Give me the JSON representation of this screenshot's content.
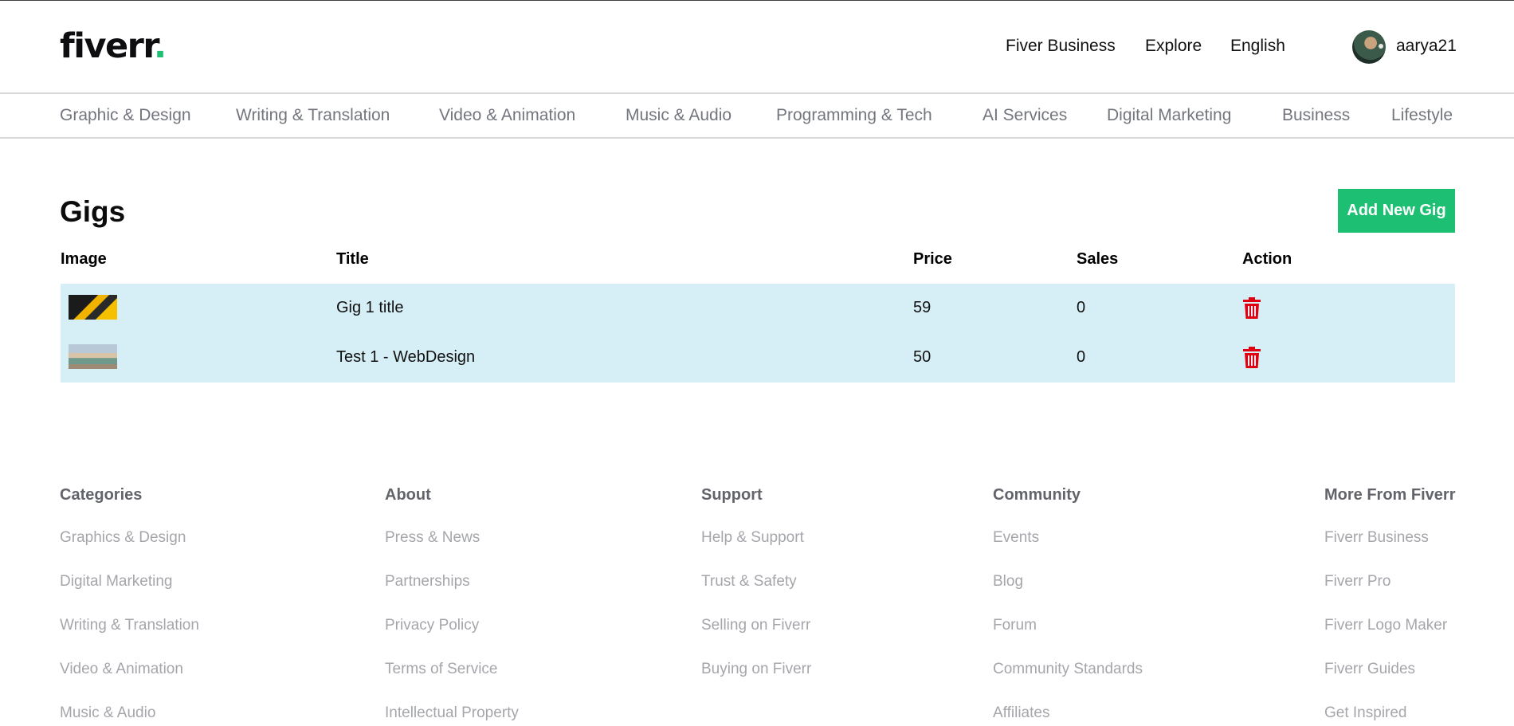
{
  "header": {
    "logo_text": "fiverr",
    "logo_dot": ".",
    "nav": [
      "Fiver Business",
      "Explore",
      "English"
    ],
    "username": "aarya21"
  },
  "categories": [
    "Graphic & Design",
    "Writing & Translation",
    "Video & Animation",
    "Music & Audio",
    "Programming & Tech",
    "AI Services",
    "Digital Marketing",
    "Business",
    "Lifestyle"
  ],
  "main": {
    "title": "Gigs",
    "add_button": "Add New Gig",
    "columns": [
      "Image",
      "Title",
      "Price",
      "Sales",
      "Action"
    ],
    "rows": [
      {
        "title": "Gig 1 title",
        "price": "59",
        "sales": "0",
        "image_icon": "gig-image-abstract"
      },
      {
        "title": "Test 1 - WebDesign",
        "price": "50",
        "sales": "0",
        "image_icon": "gig-image-building"
      }
    ],
    "action_icon": "trash-icon",
    "action_color": "#e0000f"
  },
  "footer": {
    "columns": [
      {
        "heading": "Categories",
        "links": [
          "Graphics & Design",
          "Digital Marketing",
          "Writing & Translation",
          "Video & Animation",
          "Music & Audio"
        ]
      },
      {
        "heading": "About",
        "links": [
          "Press & News",
          "Partnerships",
          "Privacy Policy",
          "Terms of Service",
          "Intellectual Property"
        ]
      },
      {
        "heading": "Support",
        "links": [
          "Help & Support",
          "Trust & Safety",
          "Selling on Fiverr",
          "Buying on Fiverr"
        ]
      },
      {
        "heading": "Community",
        "links": [
          "Events",
          "Blog",
          "Forum",
          "Community Standards",
          "Affiliates"
        ]
      },
      {
        "heading": "More From Fiverr",
        "links": [
          "Fiverr Business",
          "Fiverr Pro",
          "Fiverr Logo Maker",
          "Fiverr Guides",
          "Get Inspired"
        ]
      }
    ]
  },
  "colors": {
    "brand_green": "#1dbf73",
    "row_bg": "#d6eff6",
    "trash_red": "#e0000f"
  }
}
